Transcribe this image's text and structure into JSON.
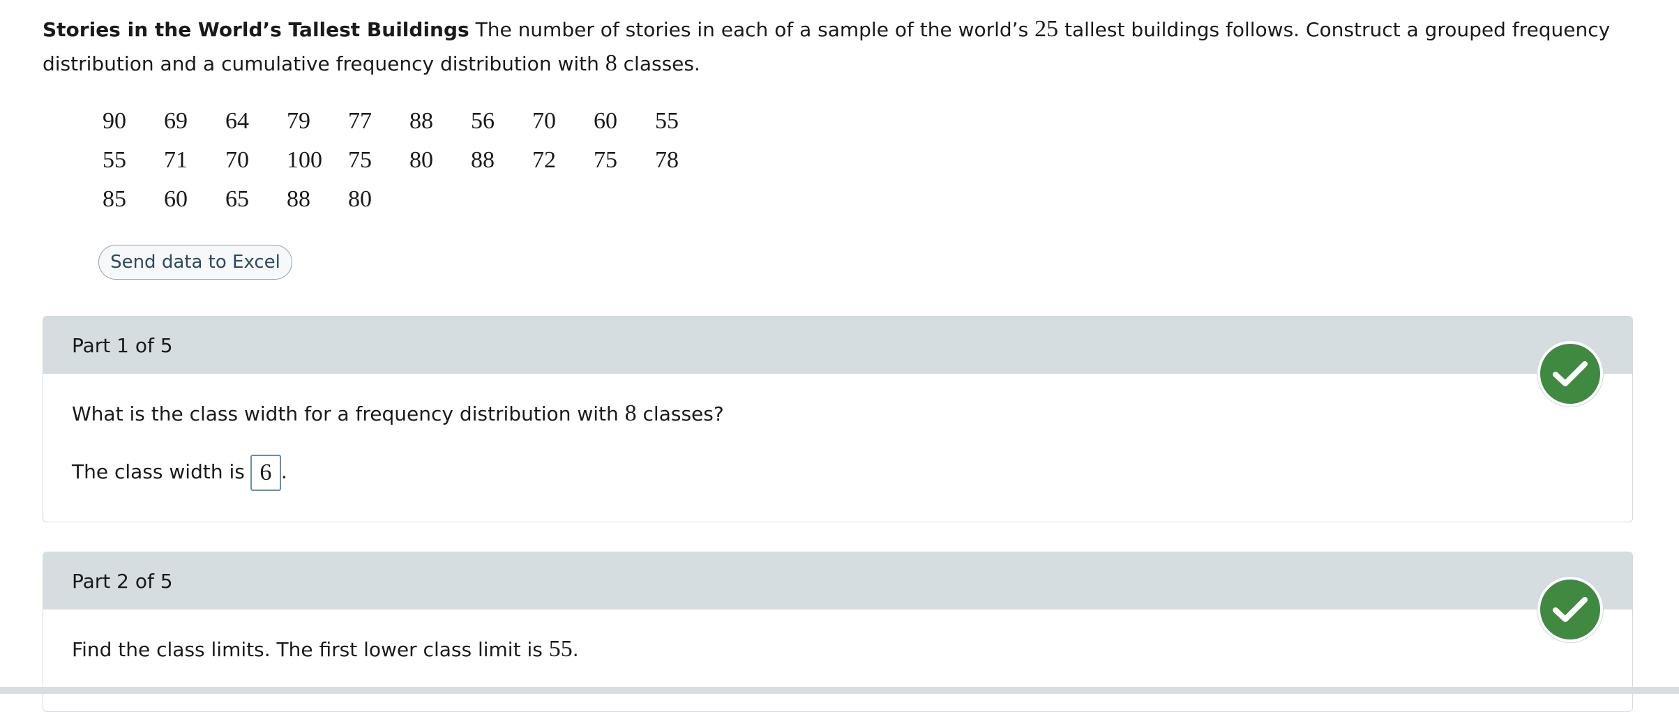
{
  "problem": {
    "title": "Stories in the World’s Tallest Buildings",
    "text_1": " The number of stories in each of a sample of the world’s ",
    "sample_size": "25",
    "text_2": " tallest buildings follows. Construct a grouped frequency distribution and a cumulative frequency distribution with ",
    "num_classes": "8",
    "text_3": " classes."
  },
  "data_rows": [
    [
      "90",
      "69",
      "64",
      "79",
      "77",
      "88",
      "56",
      "70",
      "60",
      "55"
    ],
    [
      "55",
      "71",
      "70",
      "100",
      "75",
      "80",
      "88",
      "72",
      "75",
      "78"
    ],
    [
      "85",
      "60",
      "65",
      "88",
      "80"
    ]
  ],
  "excel_button": {
    "label": "Send data to Excel"
  },
  "part1": {
    "header": "Part 1 of 5",
    "question_1": "What is the class width for a frequency distribution with ",
    "question_num": "8",
    "question_2": " classes?",
    "answer_prefix": "The class width is",
    "answer_value": "6",
    "answer_suffix": ".",
    "status_icon": "checkmark-icon",
    "status_color": "#3f8a40"
  },
  "part2": {
    "header": "Part 2 of 5",
    "text_1": "Find the class limits. The first lower class limit is ",
    "lower_limit": "55",
    "text_2": ".",
    "status_icon": "checkmark-icon",
    "status_color": "#3f8a40"
  }
}
